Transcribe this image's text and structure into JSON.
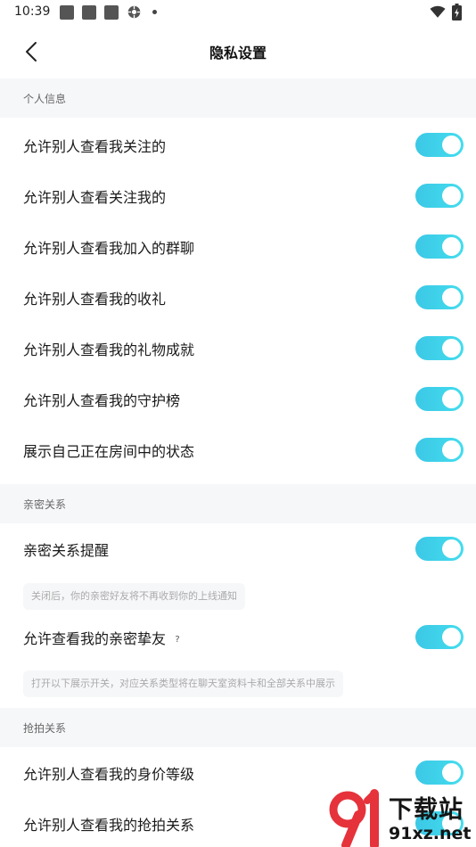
{
  "status_bar": {
    "time": "10:39"
  },
  "nav": {
    "title": "隐私设置"
  },
  "sections": {
    "personal": {
      "title": "个人信息"
    },
    "intimate": {
      "title": "亲密关系"
    },
    "grab": {
      "title": "抢拍关系"
    }
  },
  "rows": [
    {
      "label": "允许别人查看我关注的",
      "on": true
    },
    {
      "label": "允许别人查看关注我的",
      "on": true
    },
    {
      "label": "允许别人查看我加入的群聊",
      "on": true
    },
    {
      "label": "允许别人查看我的收礼",
      "on": true
    },
    {
      "label": "允许别人查看我的礼物成就",
      "on": true
    },
    {
      "label": "允许别人查看我的守护榜",
      "on": true
    },
    {
      "label": "展示自己正在房间中的状态",
      "on": true
    },
    {
      "label": "亲密关系提醒",
      "on": true
    },
    {
      "label": "允许查看我的亲密挚友",
      "on": true,
      "help": "?"
    },
    {
      "label": "允许别人查看我的身价等级",
      "on": true
    },
    {
      "label": "允许别人查看我的抢拍关系",
      "on": true
    }
  ],
  "notes": {
    "intimate_reminder": "关闭后，你的亲密好友将不再收到你的上线通知",
    "intimate_friends": "打开以下展示开关，对应关系类型将在聊天室资料卡和全部关系中展示"
  },
  "watermark": {
    "title": "下载站",
    "url": "91xz.net"
  },
  "colors": {
    "toggle_on": "#3cc8e6",
    "section_bg": "#f6f7f9",
    "watermark_red": "#e5323b"
  }
}
